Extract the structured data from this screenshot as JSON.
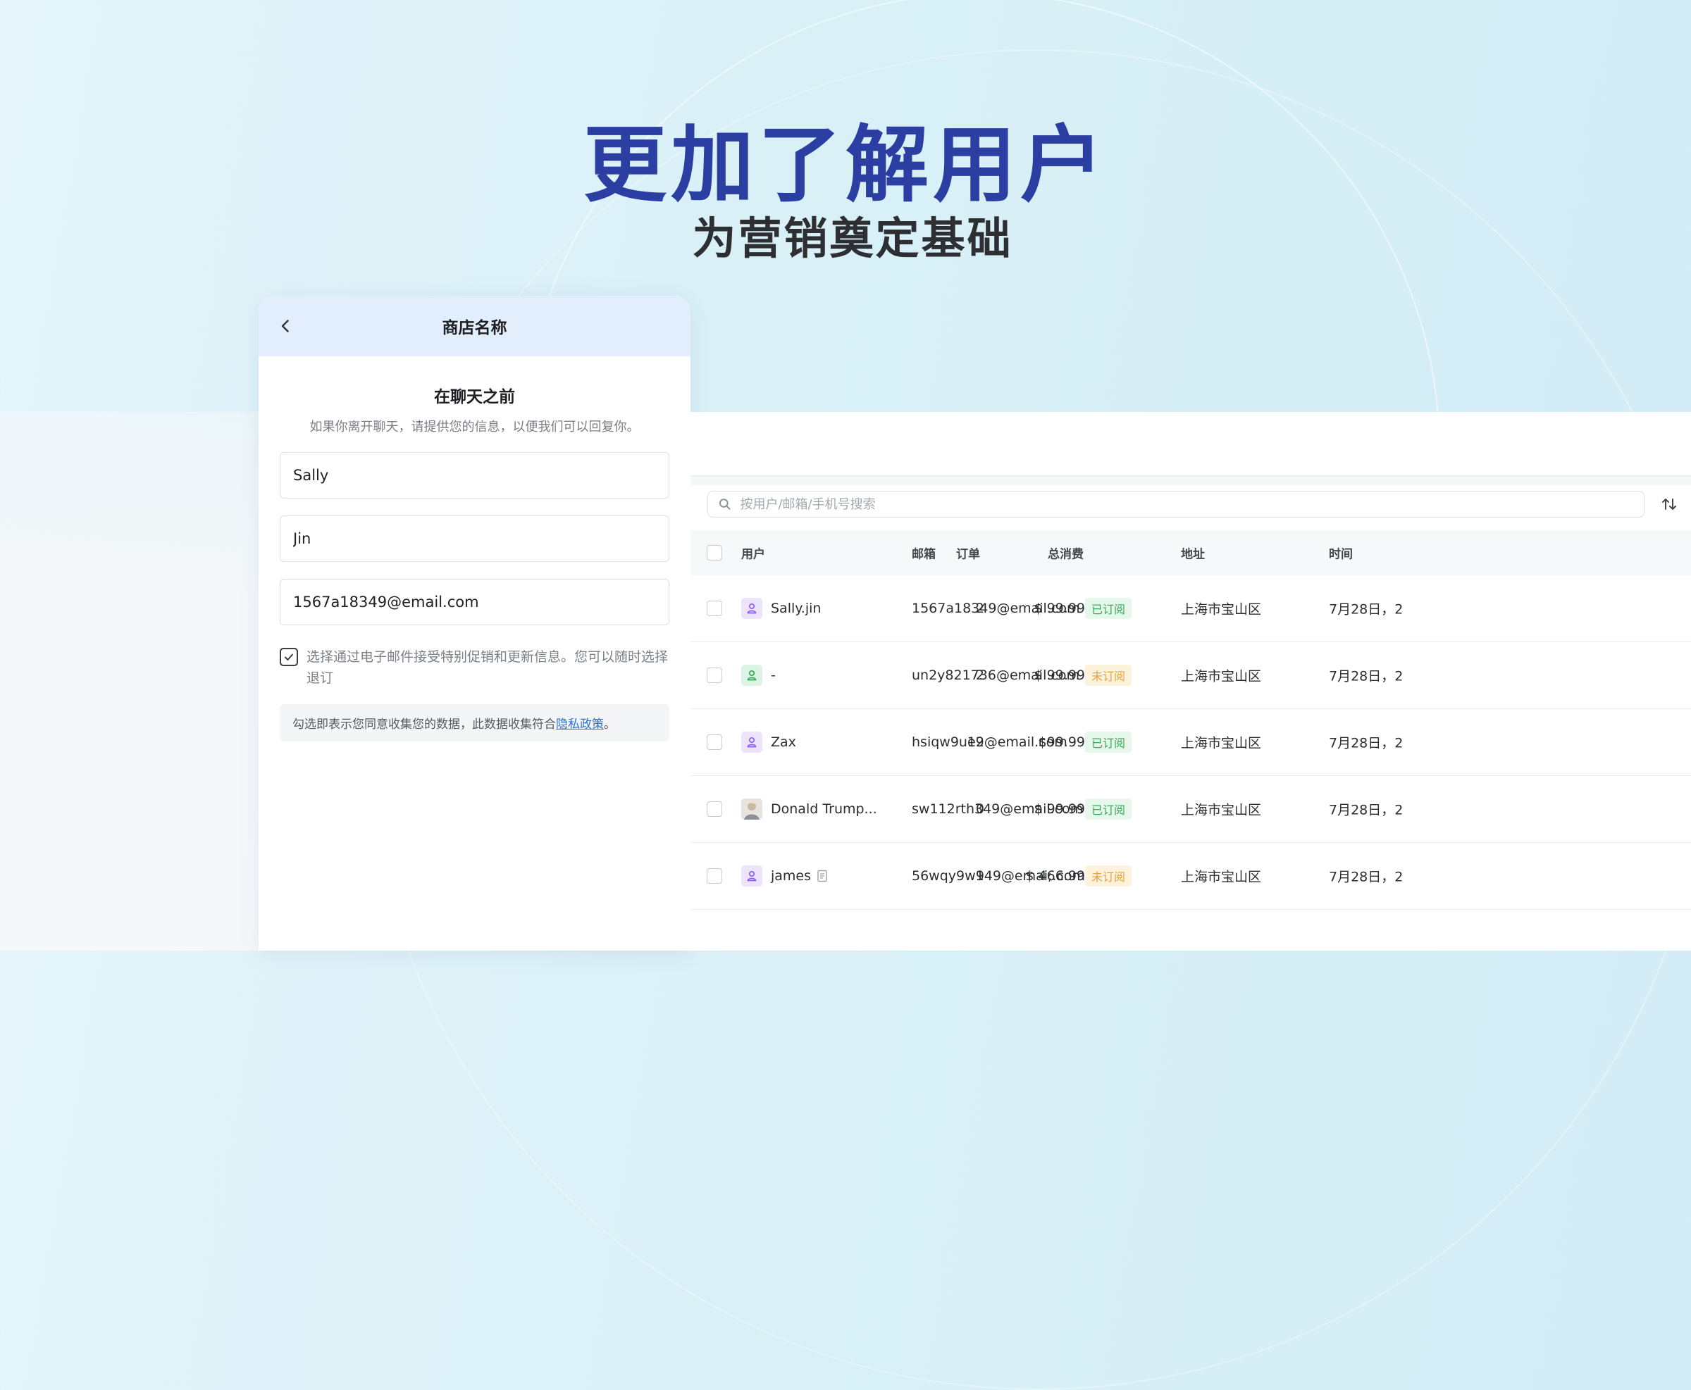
{
  "hero": {
    "title": "更加了解用户",
    "subtitle": "为营销奠定基础"
  },
  "chat": {
    "header_title": "商店名称",
    "form_title": "在聊天之前",
    "form_desc": "如果你离开聊天，请提供您的信息，以便我们可以回复你。",
    "first_name": "Sally",
    "last_name": "Jin",
    "email": "1567a18349@email.com",
    "consent_label": "选择通过电子邮件接受特别促销和更新信息。您可以随时选择退订",
    "consent_checked": true,
    "privacy_prefix": "勾选即表示您同意收集您的数据，此数据收集符合",
    "privacy_link": "隐私政策",
    "privacy_suffix": "。"
  },
  "table": {
    "search_placeholder": "按用户/邮箱/手机号搜索",
    "columns": {
      "user": "用户",
      "email": "邮箱",
      "address": "地址",
      "orders": "订单",
      "total": "总消费",
      "time": "时间"
    },
    "rows": [
      {
        "user": "Sally.jin",
        "avatar": "user-icon",
        "avatar_color": "purple",
        "email": "1567a18349@email.com",
        "status": "已订阅",
        "status_type": "subscribed",
        "address": "上海市宝山区",
        "orders": "2",
        "total": "$ 99.99",
        "time": "7月28日，2"
      },
      {
        "user": "-",
        "avatar": "user-icon",
        "avatar_color": "green",
        "email": "un2y821736@email.com",
        "status": "未订阅",
        "status_type": "unsubscribed",
        "address": "上海市宝山区",
        "orders": "2",
        "total": "$ 99.99",
        "time": "7月28日，2"
      },
      {
        "user": "Zax",
        "avatar": "user-icon",
        "avatar_color": "purple",
        "email": "hsiqw9ue9@email.com",
        "status": "已订阅",
        "status_type": "subscribed",
        "address": "上海市宝山区",
        "orders": "12",
        "total": "$99.99",
        "time": "7月28日，2"
      },
      {
        "user": "Donald Trump...",
        "avatar": "photo-avatar",
        "avatar_color": "photo",
        "email": "sw112rth349@email.com",
        "status": "已订阅",
        "status_type": "subscribed",
        "address": "上海市宝山区",
        "orders": "0",
        "total": "$ 99.99",
        "time": "7月28日，2"
      },
      {
        "user": "james",
        "avatar": "user-icon",
        "avatar_color": "purple",
        "email": "56wqy9w149@emai;.com",
        "status": "未订阅",
        "status_type": "unsubscribed",
        "address": "上海市宝山区",
        "orders": "9",
        "total": "$ 466.99",
        "time": "7月28日，2",
        "has_note": true
      }
    ]
  },
  "colors": {
    "title_blue": "#2b3fa3",
    "link_blue": "#2f6fd6",
    "subscribed_green": "#34a853",
    "unsubscribed_orange": "#e6a23c",
    "header_bg": "#e2eefc"
  }
}
